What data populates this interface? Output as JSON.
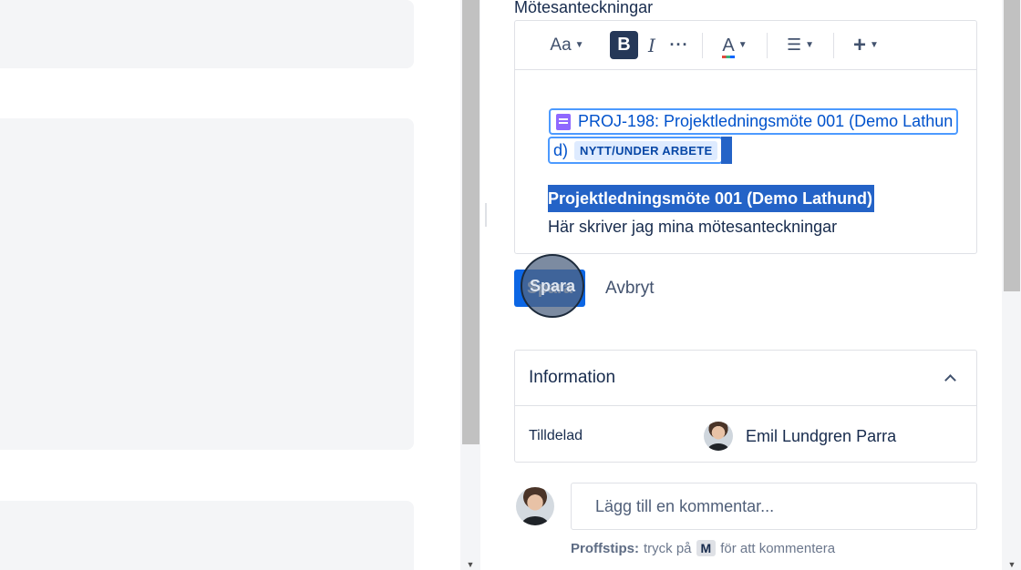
{
  "editor": {
    "section_label": "Mötesanteckningar",
    "toolbar": {
      "text_style_label": "Aa",
      "bold_label": "B",
      "italic_label": "I",
      "more_label": "···",
      "text_color_label": "A",
      "list_label": "☰",
      "insert_label": "+"
    },
    "issue_link": {
      "text_part1": "PROJ-198: Projektledningsmöte 001 (Demo Lathun",
      "text_part2": "d)",
      "status": "NYTT/UNDER ARBETE"
    },
    "heading": "Projektledningsmöte 001 (Demo Lathund)",
    "paragraph": "Här skriver jag mina mötesanteckningar"
  },
  "actions": {
    "save_label": "Spara",
    "cancel_label": "Avbryt"
  },
  "info_panel": {
    "title": "Information",
    "rows": [
      {
        "key": "Tilldelad",
        "value": "Emil Lundgren Parra"
      }
    ]
  },
  "comment": {
    "placeholder": "Lägg till en kommentar...",
    "tip_label": "Proffstips:",
    "tip_before": "tryck på",
    "tip_key": "M",
    "tip_after": "för att kommentera"
  },
  "colors": {
    "primary": "#0c66e4",
    "selection": "#2463c7",
    "status_bg": "#deebff",
    "status_text": "#0747a6",
    "page_icon": "#8f68ff"
  }
}
